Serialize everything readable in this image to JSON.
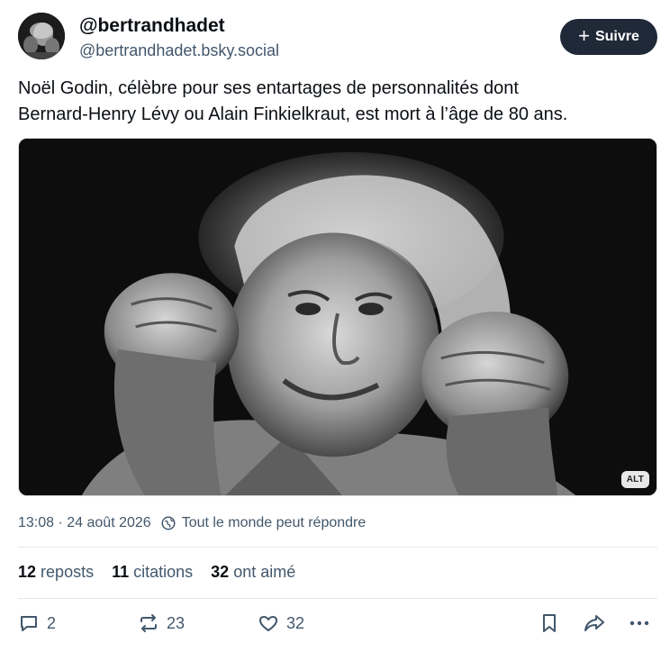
{
  "author": {
    "display_name": "@bertrandhadet",
    "handle": "@bertrandhadet.bsky.social"
  },
  "follow_button": {
    "icon": "plus-icon",
    "label": "Suivre"
  },
  "post": {
    "text_line1": "Noël Godin, célèbre pour ses entartages de personnalités dont",
    "text_line2": "Bernard-Henry Lévy ou Alain Finkielkraut, est mort à l’âge de 80 ans.",
    "image_alt_badge": "ALT"
  },
  "meta": {
    "timestamp": "13:08 · 24 août 2026",
    "reply_setting": "Tout le monde peut répondre",
    "reply_icon": "globe-icon"
  },
  "stats": [
    {
      "count": "12",
      "label": "reposts"
    },
    {
      "count": "11",
      "label": "citations"
    },
    {
      "count": "32",
      "label": "ont aimé"
    }
  ],
  "actions": {
    "reply": {
      "icon": "comment-icon",
      "count": "2"
    },
    "repost": {
      "icon": "repost-icon",
      "count": "23"
    },
    "like": {
      "icon": "heart-icon",
      "count": "32"
    },
    "bookmark": {
      "icon": "bookmark-icon"
    },
    "share": {
      "icon": "share-icon"
    },
    "more": {
      "icon": "more-icon"
    }
  },
  "colors": {
    "text": "#0b0f14",
    "muted": "#42576c",
    "button": "#1f2937",
    "divider": "#e4e8ec"
  }
}
